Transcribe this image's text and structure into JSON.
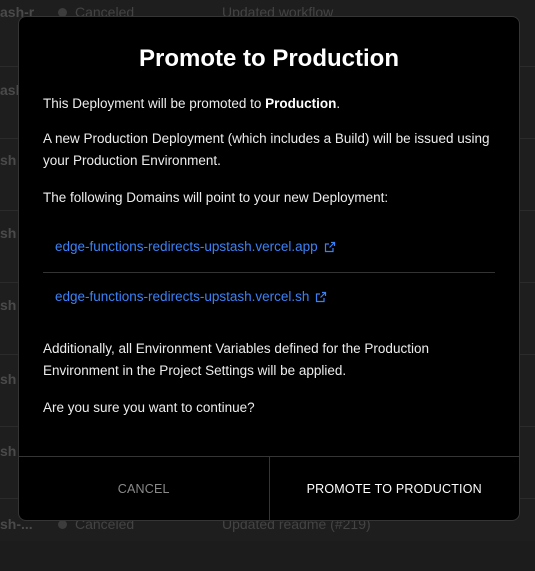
{
  "background": {
    "rows": [
      {
        "name": "ash-r",
        "status": "Canceled",
        "message": "Updated workflow"
      },
      {
        "name": "ash",
        "status": "",
        "message": ""
      },
      {
        "name": "sh",
        "status": "",
        "message": ""
      },
      {
        "name": "sh",
        "status": "",
        "message": ""
      },
      {
        "name": "sh",
        "status": "",
        "message": ""
      },
      {
        "name": "sh",
        "status": "",
        "message": ""
      },
      {
        "name": "sh",
        "status": "",
        "message": ""
      },
      {
        "name": "sh-...",
        "status": "Canceled",
        "message": "Updated readme (#219)"
      }
    ]
  },
  "modal": {
    "title": "Promote to Production",
    "intro_prefix": "This Deployment will be promoted to ",
    "intro_bold": "Production",
    "intro_suffix": ".",
    "new_deploy_text": "A new Production Deployment (which includes a Build) will be issued using your Production Environment.",
    "domains_intro": "The following Domains will point to your new Deployment:",
    "domains": [
      "edge-functions-redirects-upstash.vercel.app",
      "edge-functions-redirects-upstash.vercel.sh"
    ],
    "env_text": "Additionally, all Environment Variables defined for the Production Environment in the Project Settings will be applied.",
    "confirm_text": "Are you sure you want to continue?",
    "cancel_label": "CANCEL",
    "promote_label": "PROMOTE TO PRODUCTION"
  },
  "colors": {
    "link": "#3b82f6",
    "modal_bg": "#000000",
    "border": "#353535"
  }
}
